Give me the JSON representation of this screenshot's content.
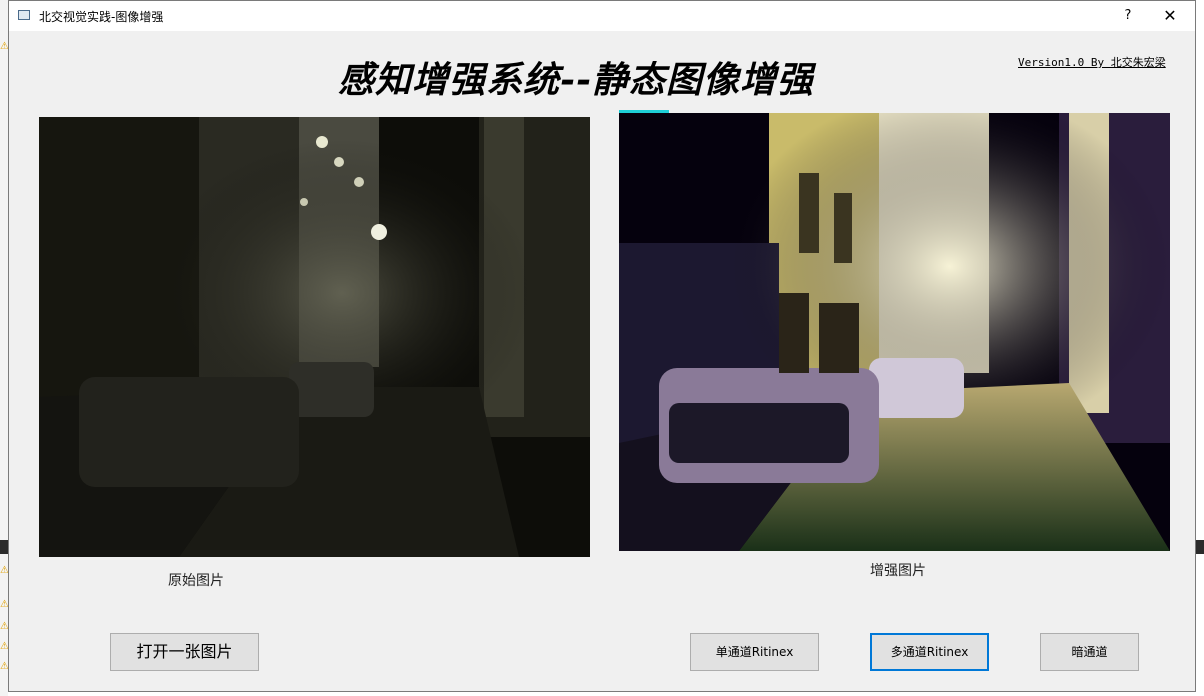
{
  "window": {
    "title": "北交视觉实践-图像增强",
    "help_label": "?",
    "close_label": "✕"
  },
  "header": {
    "title": "感知增强系统--静态图像增强",
    "version": "Version1.0 By 北交朱宏梁"
  },
  "images": {
    "original_caption": "原始图片",
    "enhanced_caption": "增强图片"
  },
  "buttons": {
    "open_label": "打开一张图片",
    "single_label": "单通道Ritinex",
    "multi_label": "多通道Ritinex",
    "dark_label": "暗通道"
  },
  "colors": {
    "focus_border": "#0078d7",
    "accent_strip": "#1ecfd6"
  }
}
